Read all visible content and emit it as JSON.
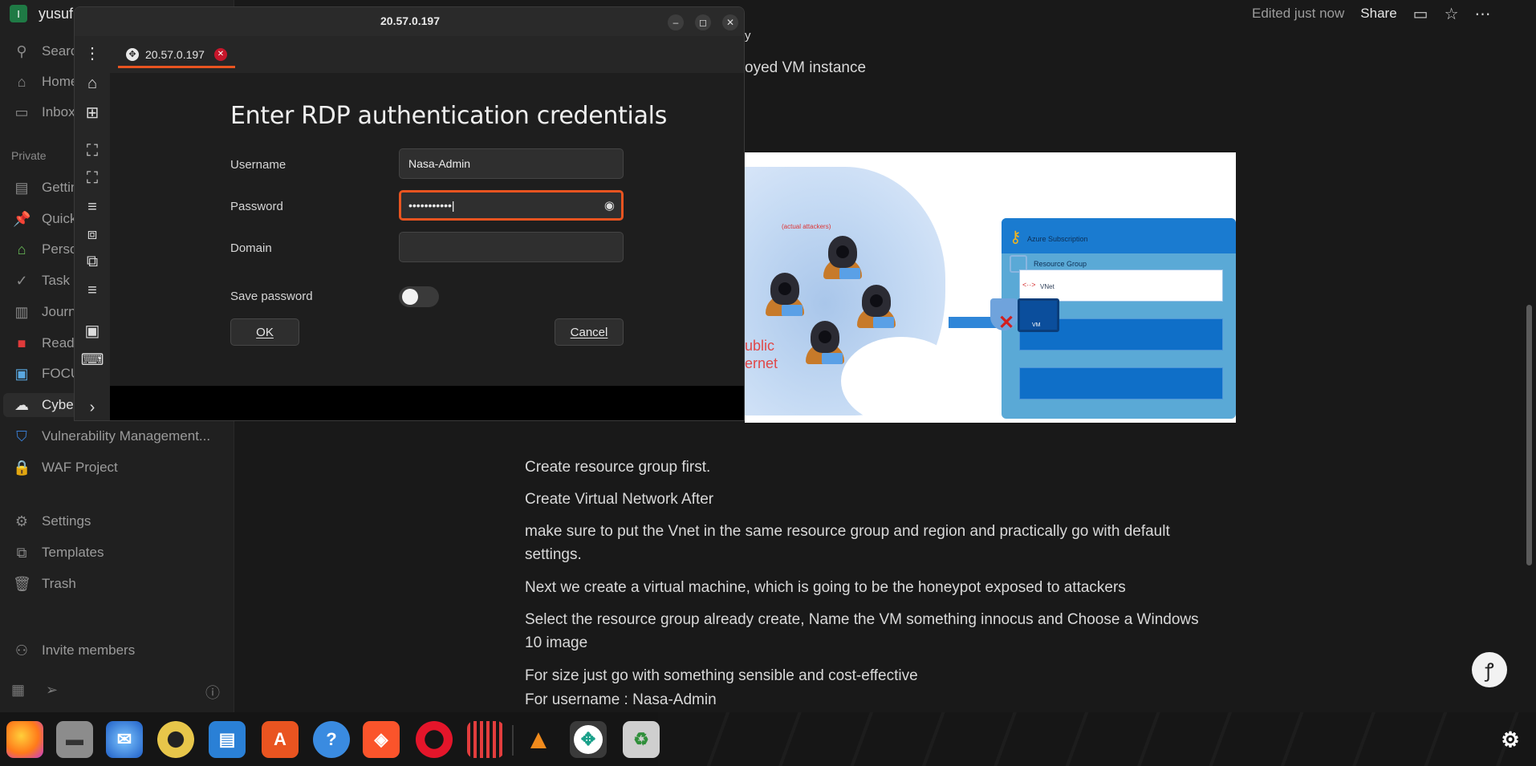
{
  "sidebar": {
    "workspace_initial": "I",
    "workspace_name": "yusuf",
    "search": "Search",
    "home": "Home",
    "inbox": "Inbox",
    "section_private": "Private",
    "pages": [
      "Getting",
      "Quick",
      "Personal",
      "Task",
      "Journal",
      "Read",
      "FOCUS",
      "Cybe",
      "Vulnerability Management...",
      "WAF Project"
    ],
    "settings": "Settings",
    "templates": "Templates",
    "trash": "Trash",
    "invite": "Invite members"
  },
  "topbar": {
    "edited": "Edited just now",
    "share": "Share"
  },
  "content": {
    "partial_top": "y",
    "partial_line": "oyed VM instance",
    "line1": "Create resource group first.",
    "line2": "Create Virtual Network After",
    "line3": "make sure to put the Vnet in the same resource group and  region and practically go with default settings.",
    "line4": "Next we create a virtual machine, which is going to be  the honeypot exposed to attackers",
    "line5": "Select the resource group already create, Name the VM something innocus and Choose a Windows 10 image",
    "line6": "For size just go with something sensible and cost-effective",
    "line7": "For username : Nasa-Admin"
  },
  "diagram": {
    "attackers_label": "(actual attackers)",
    "public_internet_1": "ublic",
    "public_internet_2": "ernet",
    "azure_subscription": "Azure Subscription",
    "resource_group": "Resource Group",
    "vnet": "VNet",
    "vm": "VM"
  },
  "remmina": {
    "window_title": "20.57.0.197",
    "tab_label": "20.57.0.197",
    "dialog_title": "Enter RDP authentication credentials",
    "username_label": "Username",
    "username_value": "Nasa-Admin",
    "password_label": "Password",
    "password_value": "•••••••••••",
    "domain_label": "Domain",
    "domain_value": "",
    "save_password_label": "Save password",
    "save_password_on": false,
    "ok_label": "OK",
    "cancel_label": "Cancel"
  },
  "colors": {
    "accent_orange": "#e95420",
    "close_red": "#c7162b",
    "notion_bg": "#191919"
  },
  "dock_apps": [
    "firefox-icon",
    "files-icon",
    "thunderbird-icon",
    "rhythmbox-icon",
    "writer-icon",
    "app-center-icon",
    "help-icon",
    "brave-icon",
    "opera-icon",
    "basket-icon",
    "vlc-icon",
    "remmina-icon",
    "trash-icon",
    "show-apps-icon"
  ]
}
